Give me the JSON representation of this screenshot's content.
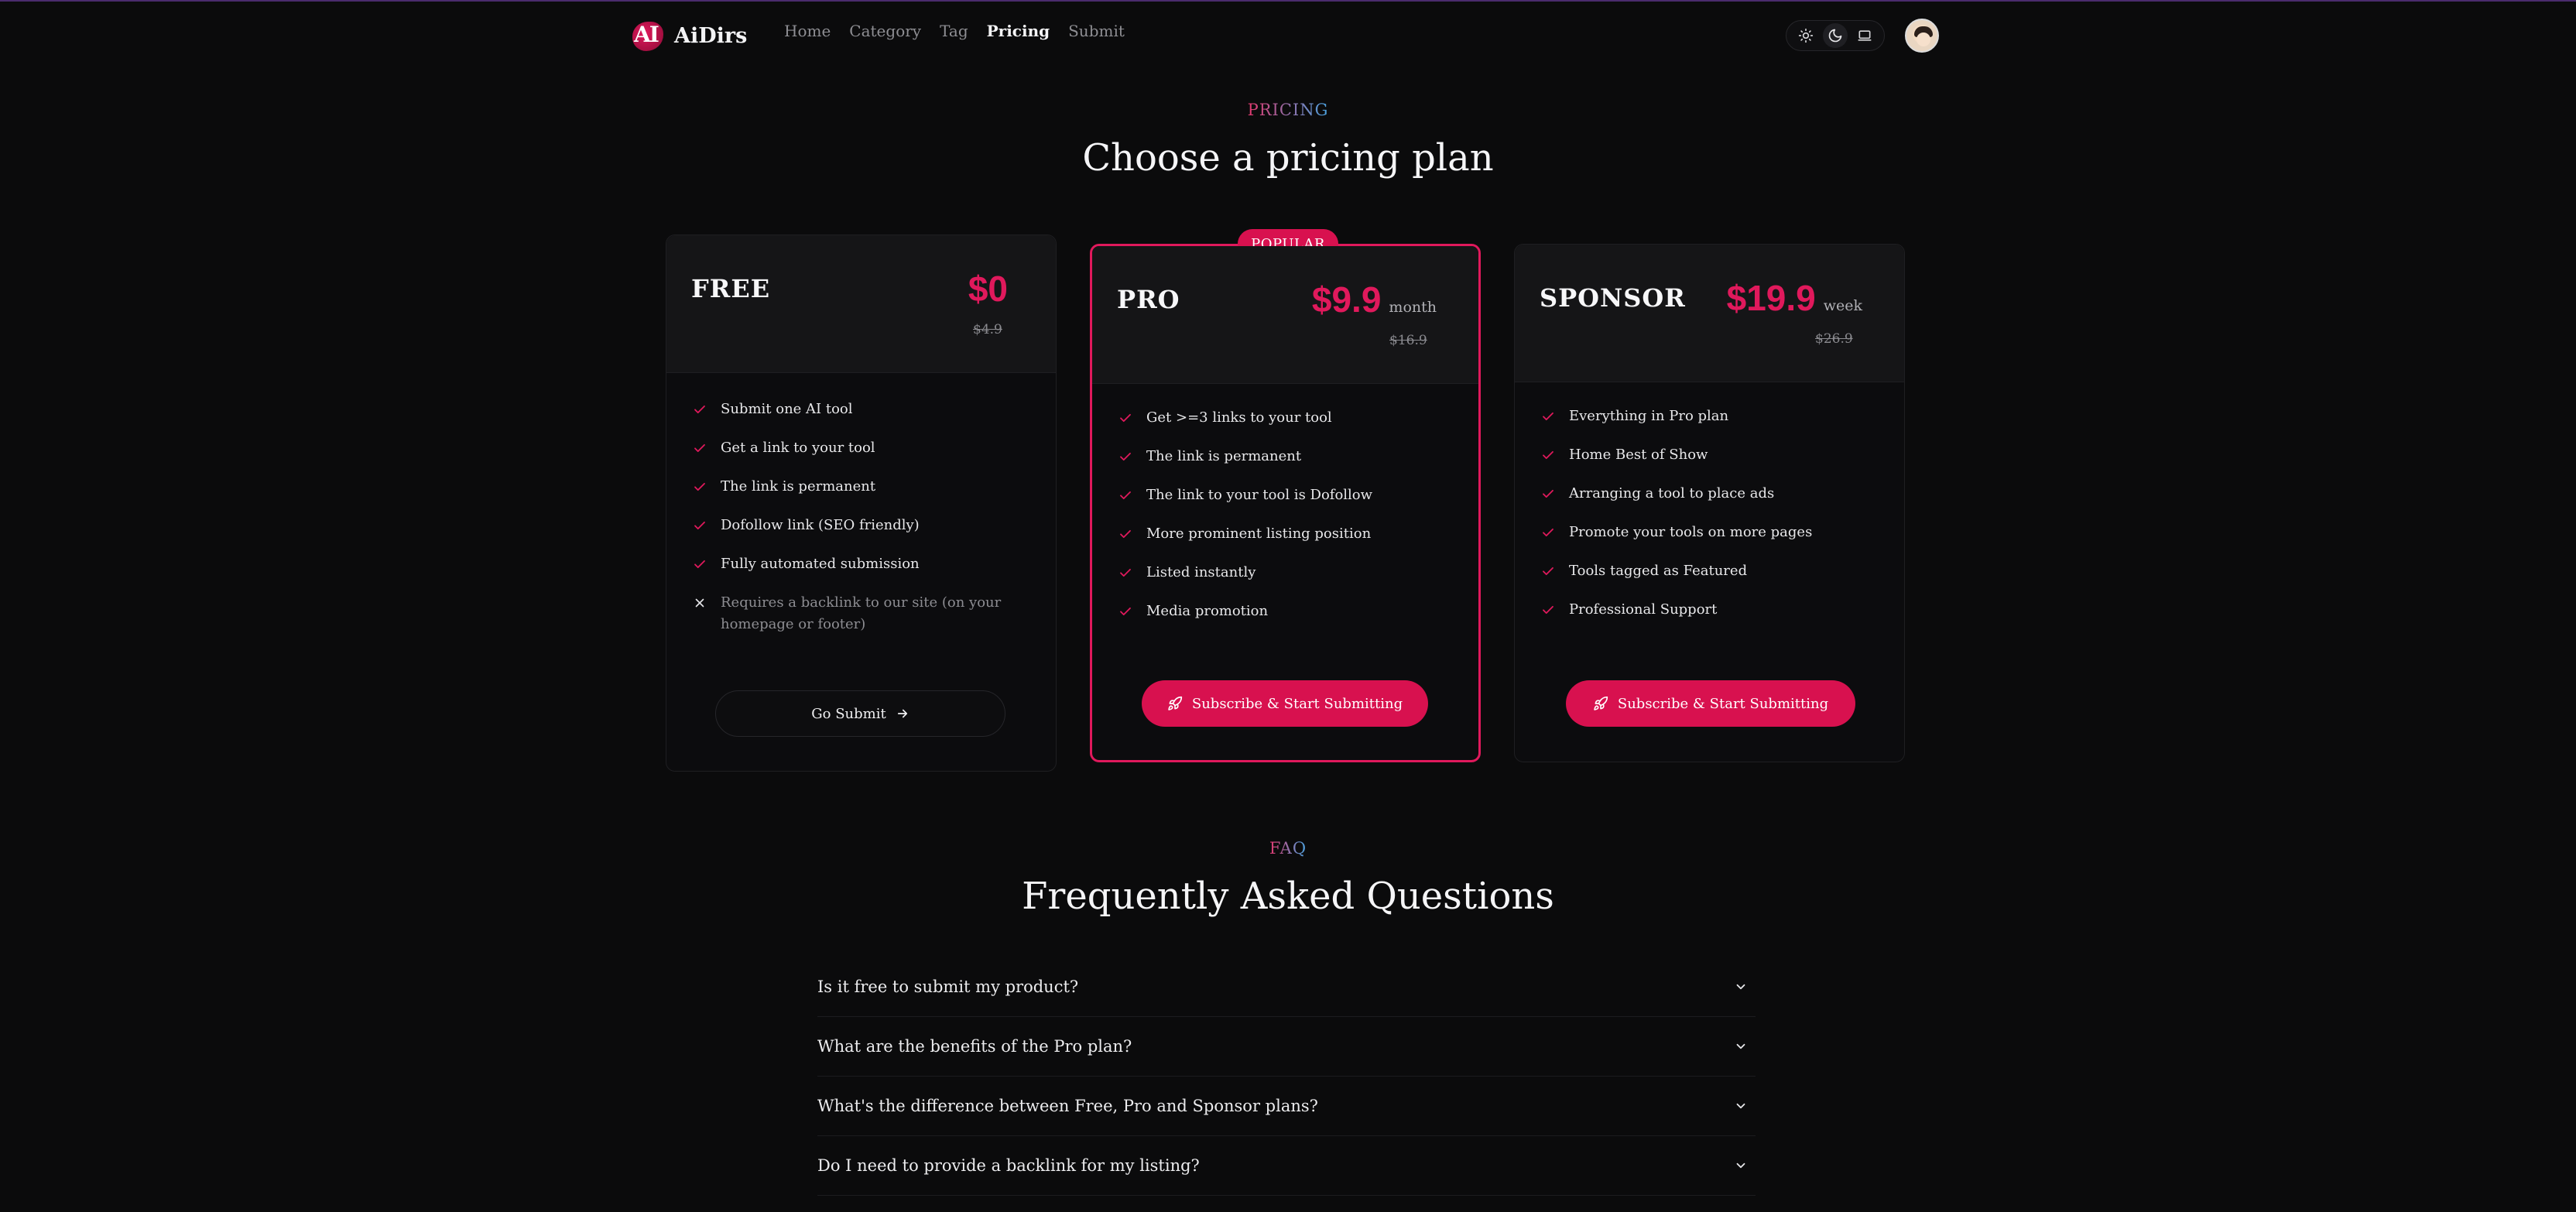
{
  "brand": {
    "logo_text": "AI",
    "name": "AiDirs"
  },
  "nav": {
    "items": [
      {
        "label": "Home",
        "active": false
      },
      {
        "label": "Category",
        "active": false
      },
      {
        "label": "Tag",
        "active": false
      },
      {
        "label": "Pricing",
        "active": true
      },
      {
        "label": "Submit",
        "active": false
      }
    ]
  },
  "theme": {
    "options": [
      "sun-icon",
      "moon-icon",
      "laptop-icon"
    ],
    "selected": "moon-icon"
  },
  "colors": {
    "accent": "#d8114f",
    "background": "#0b0b0c",
    "card": "#151517"
  },
  "pricing": {
    "eyebrow": "PRICING",
    "title": "Choose a pricing plan",
    "plans": [
      {
        "name": "FREE",
        "price": "$0",
        "period": "",
        "old_price": "$4.9",
        "features": [
          "Submit one AI tool",
          "Get a link to your tool",
          "The link is permanent",
          "Dofollow link (SEO friendly)",
          "Fully automated submission"
        ],
        "negative_feature": "Requires a backlink to our site (on your homepage or footer)",
        "cta": "Go Submit"
      },
      {
        "name": "PRO",
        "badge": "POPULAR",
        "price": "$9.9",
        "period": "month",
        "old_price": "$16.9",
        "features": [
          "Get >=3 links to your tool",
          "The link is permanent",
          "The link to your tool is Dofollow",
          "More prominent listing position",
          "Listed instantly",
          "Media promotion"
        ],
        "cta": "Subscribe & Start Submitting"
      },
      {
        "name": "SPONSOR",
        "price": "$19.9",
        "period": "week",
        "old_price": "$26.9",
        "features": [
          "Everything in Pro plan",
          "Home Best of Show",
          "Arranging a tool to place ads",
          "Promote your tools on more pages",
          "Tools tagged as Featured",
          "Professional Support"
        ],
        "cta": "Subscribe & Start Submitting"
      }
    ]
  },
  "faq": {
    "eyebrow": "FAQ",
    "title": "Frequently Asked Questions",
    "items": [
      "Is it free to submit my product?",
      "What are the benefits of the Pro plan?",
      "What's the difference between Free, Pro and Sponsor plans?",
      "Do I need to provide a backlink for my listing?"
    ]
  }
}
